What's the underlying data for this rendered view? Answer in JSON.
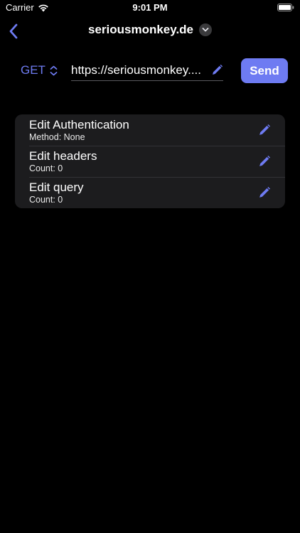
{
  "status_bar": {
    "carrier": "Carrier",
    "time": "9:01 PM",
    "icons": [
      "wifi-icon",
      "battery-icon"
    ]
  },
  "nav": {
    "title": "seriousmonkey.de",
    "back_icon": "chevron-left-icon",
    "menu_icon": "chevron-down-icon"
  },
  "request": {
    "method": "GET",
    "method_icon": "up-down-chevron-icon",
    "url": "https://seriousmonkey....",
    "url_edit_icon": "pencil-icon",
    "send_label": "Send"
  },
  "settings": {
    "items": [
      {
        "title": "Edit Authentication",
        "subtitle": "Method: None",
        "icon": "pencil-icon"
      },
      {
        "title": "Edit headers",
        "subtitle": "Count: 0",
        "icon": "pencil-icon"
      },
      {
        "title": "Edit query",
        "subtitle": "Count: 0",
        "icon": "pencil-icon"
      }
    ]
  },
  "colors": {
    "accent": "#6e7bf2",
    "background": "#000000",
    "card": "#1c1c1e"
  }
}
